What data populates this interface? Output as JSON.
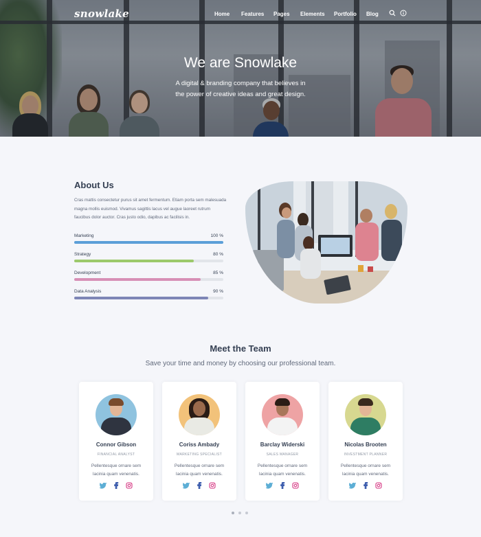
{
  "brand": {
    "logo": "snowlake"
  },
  "nav": {
    "items": [
      "Home",
      "Features",
      "Pages",
      "Elements",
      "Portfolio",
      "Blog"
    ]
  },
  "hero": {
    "title": "We are Snowlake",
    "subtitle": "A digital & branding company that believes in the power of creative ideas and great design."
  },
  "about": {
    "title": "About Us",
    "text": "Cras mattis consectetur purus sit amet fermentum. Etiam porta sem malesuada magna mollis euismod. Vivamus sagittis lacus vel augue laoreet rutrum faucibus dolor auctor. Cras justo odio, dapibus ac facilisis in.",
    "skills": [
      {
        "label": "Marketing",
        "percent_text": "100 %",
        "value": 100,
        "color": "#5b9fd8"
      },
      {
        "label": "Strategy",
        "percent_text": "80 %",
        "value": 80,
        "color": "#9cc96b"
      },
      {
        "label": "Development",
        "percent_text": "85 %",
        "value": 85,
        "color": "#d78fb6"
      },
      {
        "label": "Data Analysis",
        "percent_text": "90 %",
        "value": 90,
        "color": "#7e86b6"
      }
    ]
  },
  "team": {
    "title": "Meet the Team",
    "subtitle": "Save your time and money by choosing our professional team.",
    "members": [
      {
        "name": "Connor Gibson",
        "role": "FINANCIAL ANALYST",
        "text": "Pellentesque ornare sem lacinia quam venenatis.",
        "bg": "#8fc3df",
        "hair": "#7a4b2c",
        "shirt": "#2f3440"
      },
      {
        "name": "Coriss Ambady",
        "role": "MARKETING SPECIALIST",
        "text": "Pellentesque ornare sem lacinia quam venenatis.",
        "bg": "#f2c27a",
        "hair": "#2a1c16",
        "shirt": "#e9eae4"
      },
      {
        "name": "Barclay Widerski",
        "role": "SALES MANAGER",
        "text": "Pellentesque ornare sem lacinia quam venenatis.",
        "bg": "#eea3a4",
        "hair": "#2b1d16",
        "shirt": "#f3f3f3"
      },
      {
        "name": "Nicolas Brooten",
        "role": "INVESTMENT PLANNER",
        "text": "Pellentesque ornare sem lacinia quam venenatis.",
        "bg": "#d7d890",
        "hair": "#3a2a1e",
        "shirt": "#2e7d63"
      }
    ]
  },
  "colors": {
    "twitter": "#5daed5",
    "facebook": "#3f5fae",
    "instagram": "#d53581"
  },
  "carousel": {
    "pages": 3,
    "active": 0
  }
}
